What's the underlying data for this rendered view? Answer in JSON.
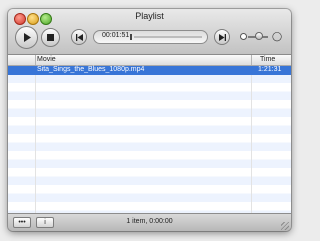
{
  "window": {
    "title": "Playlist"
  },
  "toolbar": {
    "current_time": "00:01:51",
    "icons": {
      "play": "play-icon",
      "stop": "stop-icon",
      "previous": "skip-back-icon",
      "next": "skip-forward-icon",
      "volume_low": "volume-low-icon",
      "volume_high": "volume-high-icon"
    }
  },
  "table": {
    "columns": [
      "Movie",
      "Time"
    ],
    "rows": [
      {
        "movie": "Sita_Sings_the_Blues_1080p.mp4",
        "time": "1:21:31",
        "selected": true
      }
    ]
  },
  "statusbar": {
    "more_label": "•••",
    "info_label": "i",
    "summary": "1 item, 0:00:00"
  },
  "colors": {
    "selection": "#3875d7",
    "stripe": "#edf3fe"
  }
}
